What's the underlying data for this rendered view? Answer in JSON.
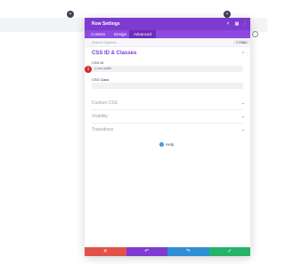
{
  "background": {
    "dot_left": "+",
    "dot_right": "+"
  },
  "modal": {
    "title": "Row Settings",
    "header_icons": {
      "close": "×",
      "cols": "▦",
      "expand": "⋮"
    },
    "tabs": [
      {
        "label": "Content"
      },
      {
        "label": "Design"
      },
      {
        "label": "Advanced"
      }
    ],
    "search_placeholder": "Search Options",
    "filter_label": "+ Filter",
    "section_open": {
      "title": "CSS ID & Classes",
      "fields": [
        {
          "label": "CSS ID",
          "value": "c-nav-width"
        },
        {
          "label": "CSS Class",
          "value": ""
        }
      ]
    },
    "sections_collapsed": [
      {
        "label": "Custom CSS"
      },
      {
        "label": "Visibility"
      },
      {
        "label": "Transitions"
      }
    ],
    "help_label": "Help",
    "footer_buttons": [
      {
        "label": "✕",
        "color": "#e2524a"
      },
      {
        "label": "↶",
        "color": "#7e3bd0"
      },
      {
        "label": "↷",
        "color": "#2f8ed6"
      },
      {
        "label": "✓",
        "color": "#27b26a"
      }
    ],
    "badge": "1"
  },
  "colors": {
    "header": "#7e3bd0",
    "tabs": "#8e4ae0",
    "accent_badge": "#cf2a2a"
  }
}
